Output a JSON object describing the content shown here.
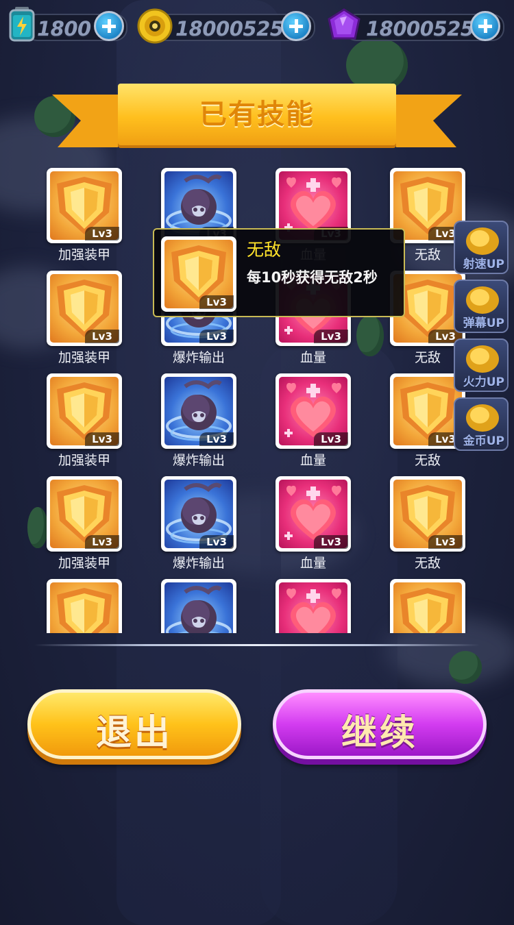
{
  "resources": {
    "energy": {
      "value": "1800",
      "icon": "battery-icon"
    },
    "coins": {
      "value": "18000525",
      "icon": "coin-icon"
    },
    "gems": {
      "value": "18000525",
      "icon": "gem-icon"
    }
  },
  "banner": {
    "title": "已有技能"
  },
  "level_label": "Lv3",
  "skills": [
    {
      "type": "armor",
      "name": "加强装甲",
      "icon": "shield-icon"
    },
    {
      "type": "bomb",
      "name": "爆炸输出",
      "icon": "bomb-icon"
    },
    {
      "type": "hp",
      "name": "血量",
      "icon": "heart-icon"
    },
    {
      "type": "invincible",
      "name": "无敌",
      "icon": "shield-icon"
    }
  ],
  "grid_rows": 5,
  "side_buttons": [
    {
      "label": "射速UP",
      "icon": "bullet-icon"
    },
    {
      "label": "弹幕UP",
      "icon": "bullet-icon"
    },
    {
      "label": "火力UP",
      "icon": "bullet-icon"
    },
    {
      "label": "金币UP",
      "icon": "coin-up-icon"
    }
  ],
  "tooltip": {
    "title": "无敌",
    "description": "每10秒获得无敌2秒",
    "level": "Lv3"
  },
  "buttons": {
    "exit": "退出",
    "continue": "继续"
  },
  "colors": {
    "gold": "#ffc21a",
    "purple": "#d33cf0",
    "tooltip_title": "#ffe22a"
  }
}
